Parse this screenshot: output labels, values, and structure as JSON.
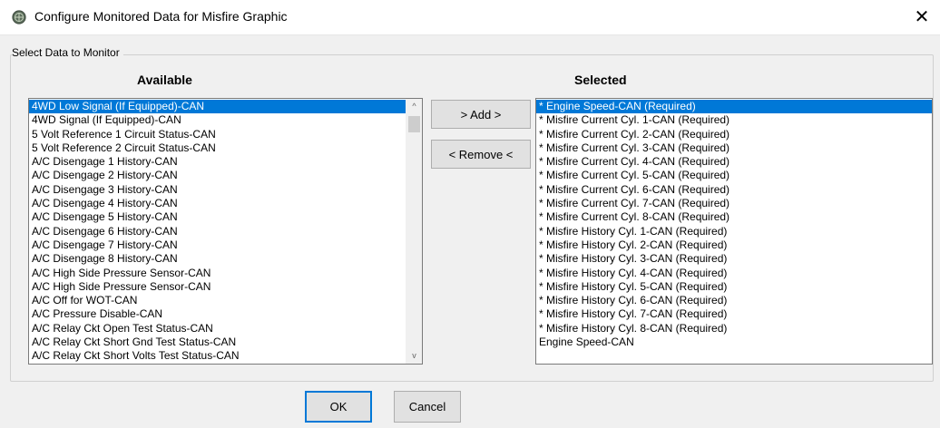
{
  "window": {
    "title": "Configure Monitored Data for Misfire Graphic",
    "close_glyph": "✕",
    "title_icon": "app-globe-icon"
  },
  "group": {
    "label": "Select Data to Monitor"
  },
  "available": {
    "header": "Available",
    "items": [
      "4WD Low Signal (If Equipped)-CAN",
      "4WD Signal (If Equipped)-CAN",
      "5 Volt Reference 1 Circuit Status-CAN",
      "5 Volt Reference 2 Circuit Status-CAN",
      "A/C Disengage 1 History-CAN",
      "A/C Disengage 2 History-CAN",
      "A/C Disengage 3 History-CAN",
      "A/C Disengage 4 History-CAN",
      "A/C Disengage 5 History-CAN",
      "A/C Disengage 6 History-CAN",
      "A/C Disengage 7 History-CAN",
      "A/C Disengage 8 History-CAN",
      "A/C High Side Pressure Sensor-CAN",
      "A/C High Side Pressure Sensor-CAN",
      "A/C Off for WOT-CAN",
      "A/C Pressure Disable-CAN",
      "A/C Relay Ckt Open Test Status-CAN",
      "A/C Relay Ckt Short Gnd Test Status-CAN",
      "A/C Relay Ckt Short Volts Test Status-CAN"
    ],
    "selected_index": 0,
    "scroll_up": "^",
    "scroll_down": "v"
  },
  "buttons": {
    "add": "> Add >",
    "remove": "< Remove <",
    "ok": "OK",
    "cancel": "Cancel"
  },
  "selected": {
    "header": "Selected",
    "items": [
      "* Engine Speed-CAN (Required)",
      "* Misfire Current Cyl. 1-CAN (Required)",
      "* Misfire Current Cyl. 2-CAN (Required)",
      "* Misfire Current Cyl. 3-CAN (Required)",
      "* Misfire Current Cyl. 4-CAN (Required)",
      "* Misfire Current Cyl. 5-CAN (Required)",
      "* Misfire Current Cyl. 6-CAN (Required)",
      "* Misfire Current Cyl. 7-CAN (Required)",
      "* Misfire Current Cyl. 8-CAN (Required)",
      "* Misfire History Cyl. 1-CAN (Required)",
      "* Misfire History Cyl. 2-CAN (Required)",
      "* Misfire History Cyl. 3-CAN (Required)",
      "* Misfire History Cyl. 4-CAN (Required)",
      "* Misfire History Cyl. 5-CAN (Required)",
      "* Misfire History Cyl. 6-CAN (Required)",
      "* Misfire History Cyl. 7-CAN (Required)",
      "* Misfire History Cyl. 8-CAN (Required)",
      "Engine Speed-CAN"
    ],
    "selected_index": 0
  },
  "colors": {
    "selection": "#0078d7",
    "default_border": "#0078d7"
  }
}
